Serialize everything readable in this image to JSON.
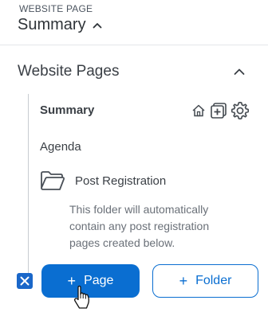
{
  "header": {
    "eyebrow": "WEBSITE PAGE",
    "title": "Summary"
  },
  "section": {
    "title": "Website Pages"
  },
  "pages": [
    {
      "label": "Summary"
    },
    {
      "label": "Agenda"
    }
  ],
  "folder": {
    "label": "Post Registration",
    "note": "This folder will automatically contain any post registration pages created below."
  },
  "actions": {
    "add_page_label": "Page",
    "add_folder_label": "Folder",
    "plus_glyph": "+"
  },
  "colors": {
    "accent": "#0a6ed1",
    "checkbox": "#1a67c9"
  },
  "icons": [
    "chevron-up-icon",
    "home-icon",
    "add-box-icon",
    "gear-icon",
    "folder-icon",
    "close-icon",
    "pointer-cursor-icon"
  ]
}
